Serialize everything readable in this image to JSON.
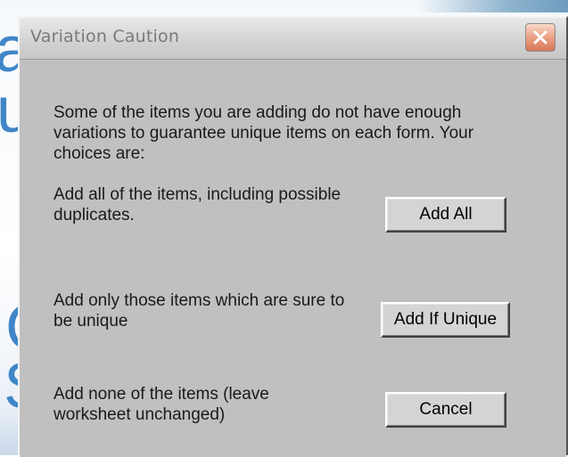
{
  "background": {
    "fragments": [
      "a",
      "ut",
      "C",
      "S"
    ]
  },
  "dialog": {
    "title": "Variation Caution",
    "close_icon": "close-icon",
    "intro_text": "Some of the items you are adding do not have enough variations to guarantee unique items on each form. Your choices are:",
    "options": [
      {
        "description": "Add all of the items, including possible duplicates.",
        "button_label": "Add All"
      },
      {
        "description": "Add only those items which are sure to be unique",
        "button_label": "Add If Unique"
      },
      {
        "description": "Add none of the items (leave worksheet unchanged)",
        "button_label": "Cancel"
      }
    ]
  },
  "colors": {
    "dialog_bg": "#c0c0c0",
    "background_text": "#3f86c8",
    "close_button": "#e99c7f"
  }
}
